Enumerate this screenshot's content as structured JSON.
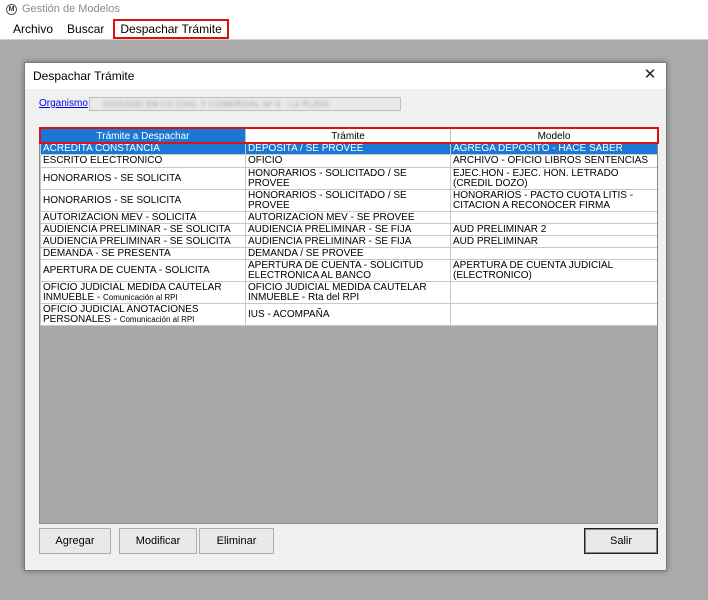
{
  "app": {
    "title": "Gestión de Modelos",
    "logo_letter": "M"
  },
  "menu": {
    "items": [
      {
        "label": "Archivo"
      },
      {
        "label": "Buscar"
      },
      {
        "label": "Despachar Trámite"
      }
    ]
  },
  "dialog": {
    "title": "Despachar Trámite",
    "close_glyph": "✕",
    "organismo_label": "Organismo",
    "organismo_value": "JUZGADO EN LO CIVIL Y COMERCIAL Nº 6 · LA PLATA",
    "columns": [
      "Trámite a Despachar",
      "Trámite",
      "Modelo"
    ],
    "rows": [
      {
        "a": "ACREDITA CONSTANCIA",
        "a2": "",
        "b": "DEPOSITA / SE PROVEE",
        "c": "AGREGA DEPOSITO - HACE SABER"
      },
      {
        "a": "ESCRITO  ELECTRONICO",
        "a2": "",
        "b": "OFICIO",
        "c": "ARCHIVO - OFICIO LIBROS SENTENCIAS"
      },
      {
        "a": "HONORARIOS - SE SOLICITA",
        "a2": "",
        "b": "HONORARIOS - SOLICITADO / SE PROVEE",
        "c": "EJEC.HON - EJEC. HON. LETRADO (CREDIL DOZO)"
      },
      {
        "a": "HONORARIOS - SE SOLICITA",
        "a2": "",
        "b": "HONORARIOS - SOLICITADO / SE PROVEE",
        "c": "HONORARIOS - PACTO CUOTA LITIS - CITACION A RECONOCER FIRMA"
      },
      {
        "a": "AUTORIZACION MEV - SOLICITA",
        "a2": "",
        "b": "AUTORIZACION MEV - SE PROVEE",
        "c": ""
      },
      {
        "a": "AUDIENCIA PRELIMINAR - SE SOLICITA",
        "a2": "",
        "b": "AUDIENCIA PRELIMINAR - SE FIJA",
        "c": "AUD PRELIMINAR 2"
      },
      {
        "a": "AUDIENCIA PRELIMINAR - SE SOLICITA",
        "a2": "",
        "b": "AUDIENCIA PRELIMINAR - SE FIJA",
        "c": "AUD PRELIMINAR"
      },
      {
        "a": "DEMANDA - SE PRESENTA",
        "a2": "",
        "b": "DEMANDA / SE PROVEE",
        "c": ""
      },
      {
        "a": "APERTURA DE CUENTA - SOLICITA",
        "a2": "",
        "b": "APERTURA DE CUENTA - SOLICITUD ELECTRONICA AL BANCO",
        "c": "APERTURA DE CUENTA JUDICIAL (ELECTRONICO)"
      },
      {
        "a": "OFICIO JUDICIAL MEDIDA CAUTELAR INMUEBLE - ",
        "a2": "Comunicación al RPI",
        "b": "OFICIO JUDICIAL MEDIDA CAUTELAR INMUEBLE - Rta del RPI",
        "c": ""
      },
      {
        "a": "OFICIO JUDICIAL ANOTACIONES PERSONALES - ",
        "a2": "Comunicación al RPI",
        "b": "IUS - ACOMPAÑA",
        "c": ""
      }
    ],
    "buttons": {
      "add": "Agregar",
      "edit": "Modificar",
      "delete": "Eliminar",
      "exit": "Salir"
    }
  }
}
